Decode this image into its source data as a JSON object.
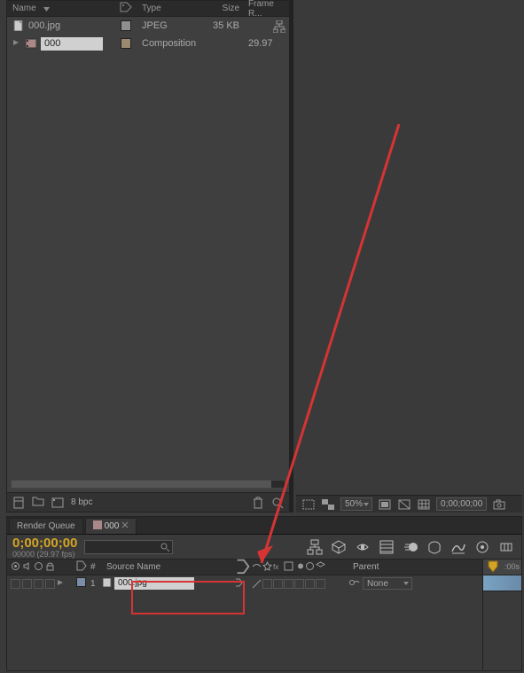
{
  "project": {
    "columns": {
      "name": "Name",
      "type": "Type",
      "size": "Size",
      "frame": "Frame R..."
    },
    "items": [
      {
        "name": "000.jpg",
        "type": "JPEG",
        "size": "35 KB",
        "frame": ""
      },
      {
        "name": "000",
        "type": "Composition",
        "size": "",
        "frame": "29.97"
      }
    ],
    "footer": {
      "bpc": "8 bpc"
    }
  },
  "viewer": {
    "zoom": "50%",
    "timecode": "0;00;00;00"
  },
  "timeline": {
    "tabs": [
      {
        "label": "Render Queue",
        "active": false
      },
      {
        "label": "000",
        "active": true,
        "closable": true
      }
    ],
    "timecode": "0;00;00;00",
    "comp_label_top": "00000 (29.97 fps)",
    "header": {
      "hash": "#",
      "source": "Source Name",
      "parent": "Parent",
      "ruler_label": ":00s"
    },
    "layers": [
      {
        "num": "1",
        "name": "000.jpg",
        "parent": "None"
      }
    ]
  }
}
